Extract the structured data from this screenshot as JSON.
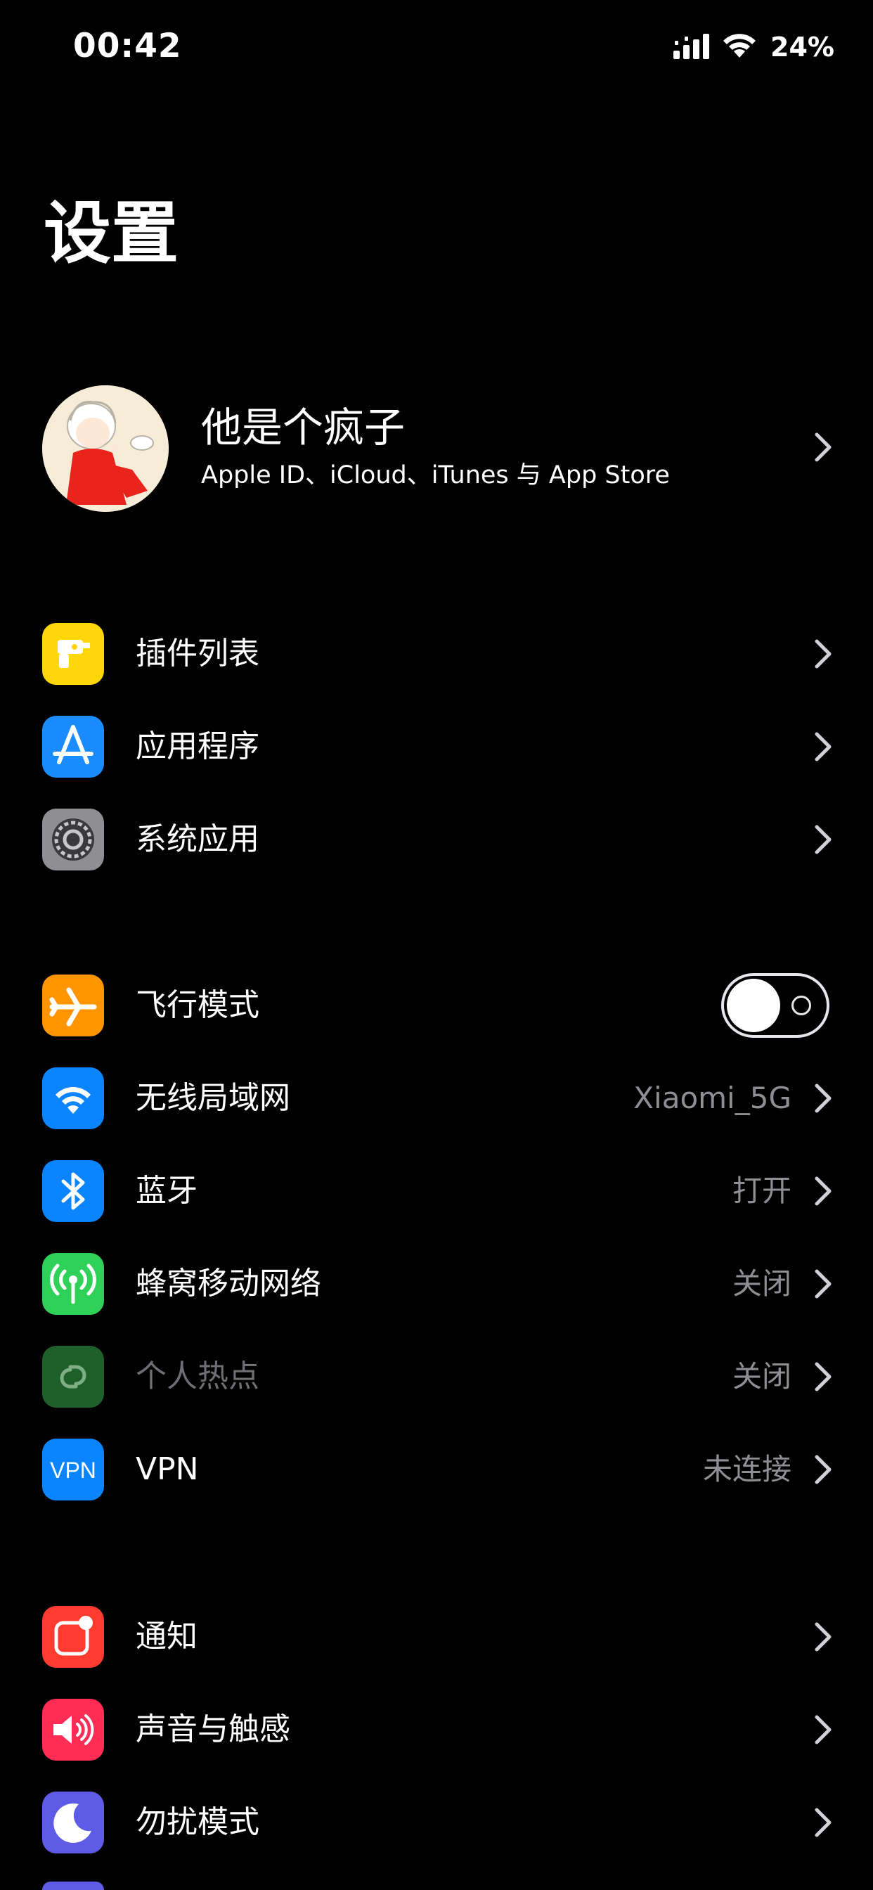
{
  "status_bar": {
    "time": "00:42",
    "battery_text": "24%",
    "icons": [
      "cellular-signal-icon",
      "wifi-icon"
    ]
  },
  "page": {
    "title": "设置"
  },
  "profile": {
    "name": "他是个疯子",
    "subtitle": "Apple ID、iCloud、iTunes 与 App Store"
  },
  "groups": [
    {
      "items": [
        {
          "label": "插件列表",
          "icon": "plugin-drill-icon",
          "color": "#ffd60a"
        },
        {
          "label": "应用程序",
          "icon": "app-store-icon",
          "color": "#1a8cff"
        },
        {
          "label": "系统应用",
          "icon": "settings-gear-icon",
          "color": "#8e8e93"
        }
      ]
    },
    {
      "items": [
        {
          "label": "飞行模式",
          "icon": "airplane-icon",
          "color": "#ff9500",
          "toggle_on": false
        },
        {
          "label": "无线局域网",
          "icon": "wifi-icon",
          "color": "#0a84ff",
          "value": "Xiaomi_5G"
        },
        {
          "label": "蓝牙",
          "icon": "bluetooth-icon",
          "color": "#0a84ff",
          "value": "打开"
        },
        {
          "label": "蜂窝移动网络",
          "icon": "cellular-antenna-icon",
          "color": "#30d158",
          "value": "关闭"
        },
        {
          "label": "个人热点",
          "icon": "hotspot-icon",
          "color": "#1f5f2a",
          "value": "关闭",
          "disabled": true
        },
        {
          "label": "VPN",
          "icon": "vpn-icon",
          "icon_text": "VPN",
          "color": "#0a84ff",
          "value": "未连接"
        }
      ]
    },
    {
      "items": [
        {
          "label": "通知",
          "icon": "notification-icon",
          "color": "#ff3b30"
        },
        {
          "label": "声音与触感",
          "icon": "speaker-icon",
          "color": "#ff2d55"
        },
        {
          "label": "勿扰模式",
          "icon": "moon-icon",
          "color": "#5e5ce6"
        }
      ]
    }
  ]
}
